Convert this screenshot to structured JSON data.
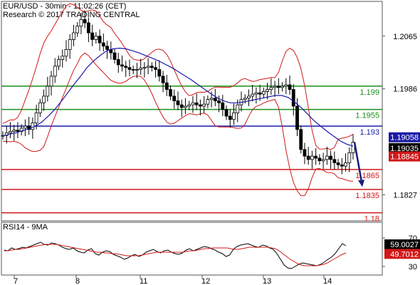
{
  "chart_data": {
    "type": "candlestick",
    "header": {
      "line1": "EUR/USD - 30min - 11:02:26 (CET)",
      "line2": "Research © 2017 TRADING CENTRAL"
    },
    "x_ticks": [
      "7",
      "8",
      "11",
      "12",
      "13",
      "14"
    ],
    "price_axis": {
      "ticks": [
        "1.2065",
        "1.1986",
        "1.1827"
      ],
      "range": [
        1.179,
        1.2115
      ]
    },
    "horizontal_levels": [
      {
        "label": "1.199",
        "value": 1.199,
        "color": "#1a8f1a"
      },
      {
        "label": "1.1955",
        "value": 1.1955,
        "color": "#1a8f1a"
      },
      {
        "label": "1.193",
        "value": 1.193,
        "color": "#1a1aa8"
      },
      {
        "label": "1.1865",
        "value": 1.1865,
        "color": "#d01818"
      },
      {
        "label": "1.1835",
        "value": 1.1835,
        "color": "#d01818"
      },
      {
        "label": "1.18",
        "value": 1.18,
        "color": "#d01818"
      }
    ],
    "price_badges": [
      {
        "label": "1.19058",
        "bg": "#1a1aa8",
        "fg": "#ffffff"
      },
      {
        "label": "1.19035",
        "bg": "#000000",
        "fg": "#ffffff"
      },
      {
        "label": "1.18845",
        "bg": "#d01818",
        "fg": "#ffffff"
      }
    ],
    "forecast_arrow_target": 1.184,
    "series": [
      {
        "name": "close",
        "color": "#000000",
        "values": [
          1.1916,
          1.192,
          1.1922,
          1.1924,
          1.1922,
          1.1927,
          1.193,
          1.1925,
          1.1935,
          1.195,
          1.1965,
          1.1975,
          1.199,
          1.2005,
          1.202,
          1.203,
          1.2035,
          1.2045,
          1.206,
          1.207,
          1.208,
          1.209,
          1.2085,
          1.207,
          1.206,
          1.2065,
          1.2055,
          1.205,
          1.2045,
          1.204,
          1.203,
          1.2022,
          1.202,
          1.2018,
          1.2015,
          1.2014,
          1.2015,
          1.2017,
          1.2018,
          1.202,
          1.2018,
          1.2015,
          1.2005,
          1.1995,
          1.1985,
          1.1975,
          1.1968,
          1.1962,
          1.1958,
          1.196,
          1.1962,
          1.1965,
          1.1962,
          1.196,
          1.1963,
          1.197,
          1.1972,
          1.1968,
          1.1965,
          1.1955,
          1.1945,
          1.194,
          1.195,
          1.1962,
          1.197,
          1.1972,
          1.1975,
          1.1978,
          1.198,
          1.1978,
          1.1982,
          1.1985,
          1.1988,
          1.199,
          1.1988,
          1.199,
          1.1992,
          1.1985,
          1.196,
          1.1925,
          1.1895,
          1.1885,
          1.188,
          1.1885,
          1.1882,
          1.1878,
          1.188,
          1.1885,
          1.188,
          1.1875,
          1.1872,
          1.187,
          1.1875,
          1.189,
          1.1906
        ]
      },
      {
        "name": "ma",
        "color": "#1a1aa8",
        "values": [
          1.1915,
          1.1918,
          1.192,
          1.1923,
          1.1926,
          1.193,
          1.1936,
          1.1945,
          1.1955,
          1.1967,
          1.198,
          1.1993,
          1.2005,
          1.2018,
          1.2028,
          1.2036,
          1.2043,
          1.2046,
          1.2047,
          1.2046,
          1.2043,
          1.204,
          1.2036,
          1.2032,
          1.2028,
          1.2023,
          1.2018,
          1.2012,
          1.2006,
          1.2,
          1.1993,
          1.1986,
          1.1979,
          1.1973,
          1.1968,
          1.1965,
          1.1965,
          1.1966,
          1.1968,
          1.197,
          1.1972,
          1.1974,
          1.1976,
          1.1976,
          1.1973,
          1.1966,
          1.1958,
          1.1948,
          1.1938,
          1.193,
          1.1922,
          1.1915,
          1.1908,
          1.1903,
          1.19
        ]
      },
      {
        "name": "rsi",
        "color": "#000000",
        "panel": "RSI14 - 9MA",
        "values": [
          53,
          52,
          56,
          54,
          55,
          57,
          56,
          58,
          60,
          62,
          64,
          61,
          60,
          63,
          62,
          60,
          57,
          55,
          54,
          56,
          52,
          50,
          49,
          53,
          55,
          48,
          46,
          50,
          52,
          51,
          47,
          45,
          43,
          40,
          42,
          45,
          47,
          44,
          46,
          50,
          52,
          54,
          51,
          49,
          52,
          53,
          50,
          48,
          47,
          49,
          53,
          55,
          52,
          54,
          56,
          58,
          57,
          55,
          53,
          50,
          48,
          44,
          46,
          54,
          58,
          60,
          61,
          62,
          60,
          58,
          57,
          60,
          59,
          56,
          54,
          48,
          40,
          32,
          28,
          27,
          30,
          33,
          35,
          34,
          33,
          32,
          31,
          33,
          36,
          40,
          43,
          48,
          55,
          62,
          59
        ]
      },
      {
        "name": "rsi-ma",
        "color": "#d01818",
        "values": [
          52,
          52,
          53,
          54,
          54,
          55,
          56,
          57,
          58,
          59,
          60,
          61,
          61,
          61,
          61,
          60,
          59,
          58,
          57,
          56,
          55,
          54,
          53,
          52,
          51,
          50,
          50,
          49,
          49,
          48,
          48,
          47,
          46,
          45,
          45,
          45,
          45,
          46,
          47,
          48,
          49,
          50,
          50,
          50,
          50,
          50,
          50,
          50,
          50,
          51,
          52,
          52,
          53,
          54,
          55,
          55,
          56,
          56,
          56,
          56,
          56,
          55,
          54,
          54,
          55,
          56,
          57,
          57,
          57,
          57,
          57,
          57,
          56,
          55,
          52,
          48,
          44,
          40,
          37,
          34,
          32,
          31,
          31,
          31,
          31,
          32,
          33,
          35,
          38,
          41,
          44,
          47,
          49
        ]
      }
    ],
    "rsi_panel": {
      "label": "RSI14 - 9MA",
      "ticks": [
        "70",
        "30"
      ],
      "range": [
        20,
        90
      ],
      "badges": [
        {
          "label": "59.0027",
          "bg": "#000000",
          "fg": "#ffffff"
        },
        {
          "label": "49.7012",
          "bg": "#d01818",
          "fg": "#ffffff"
        }
      ]
    }
  }
}
